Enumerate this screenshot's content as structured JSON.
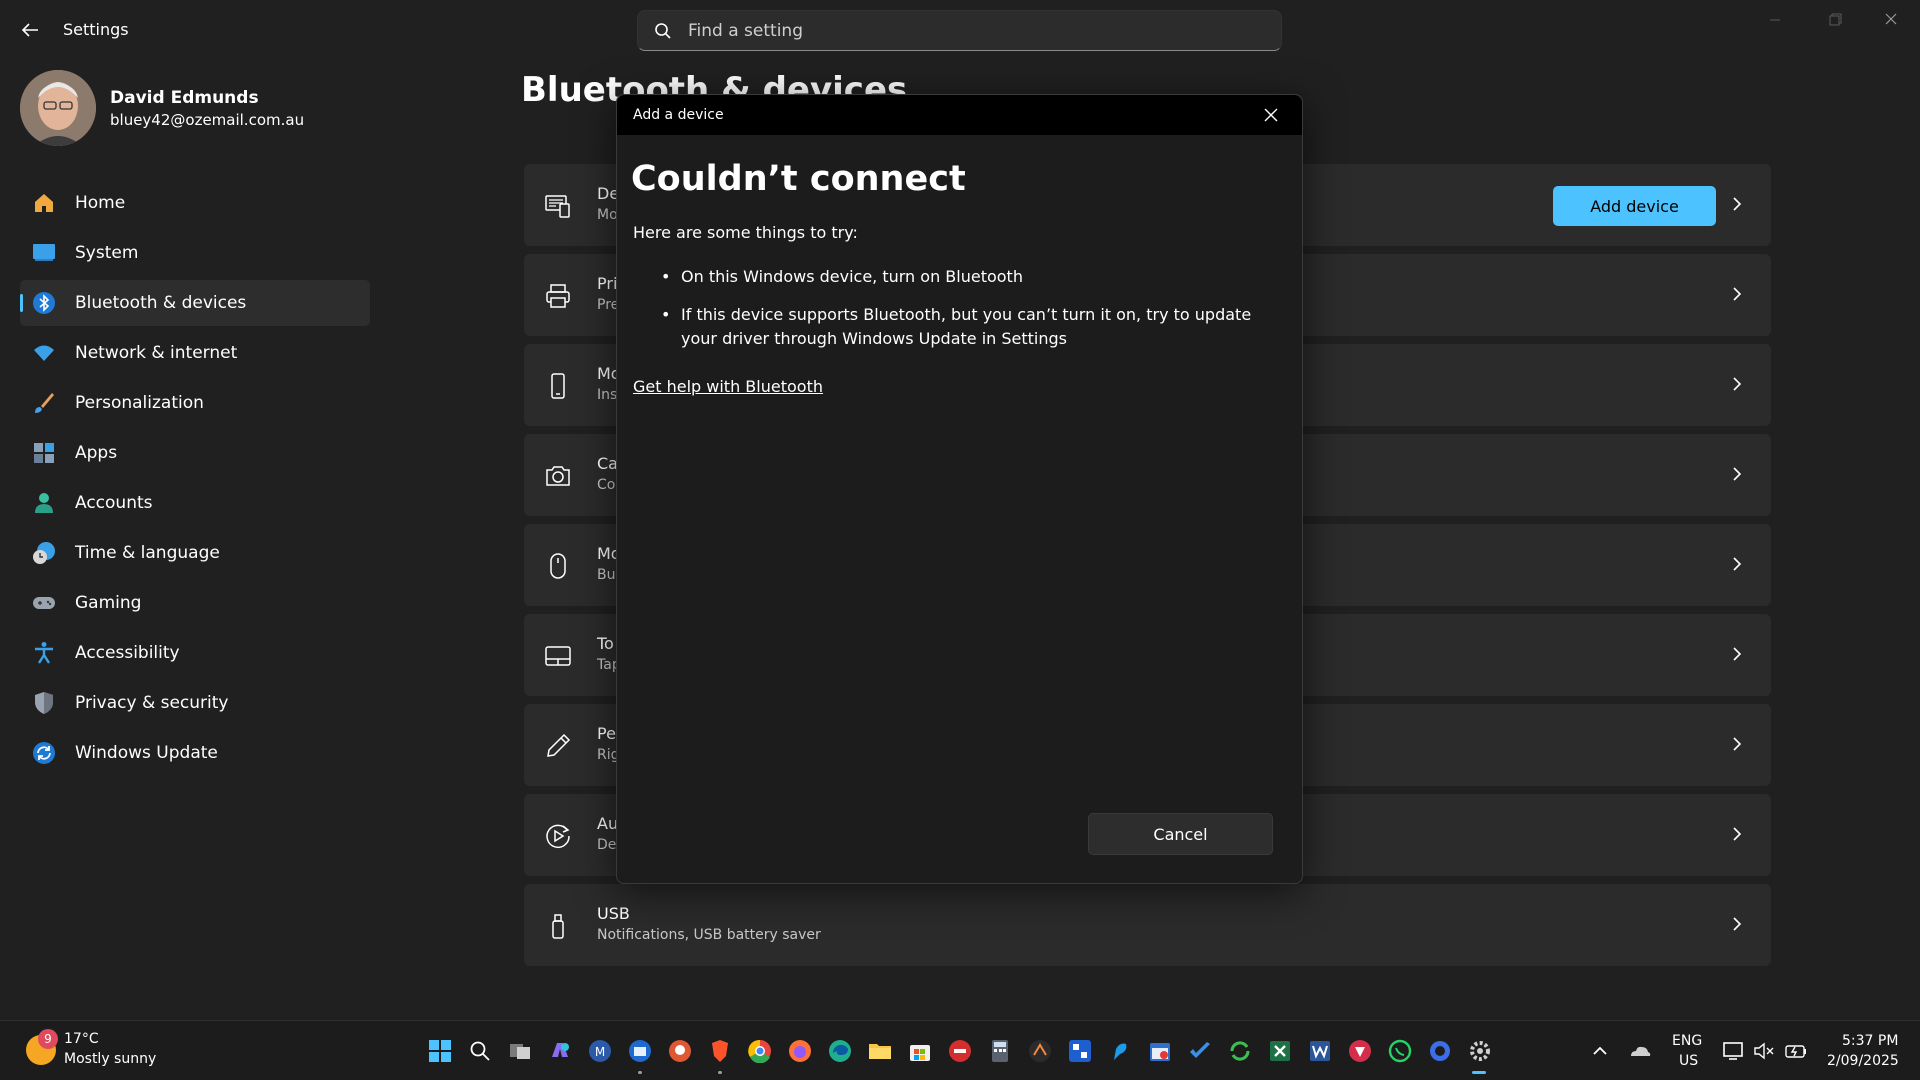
{
  "window": {
    "title": "Settings"
  },
  "search": {
    "placeholder": "Find a setting"
  },
  "profile": {
    "name": "David Edmunds",
    "email": "bluey42@ozemail.com.au"
  },
  "nav": {
    "items": [
      {
        "label": "Home",
        "icon": "home-icon"
      },
      {
        "label": "System",
        "icon": "system-icon"
      },
      {
        "label": "Bluetooth & devices",
        "icon": "bluetooth-icon",
        "selected": true
      },
      {
        "label": "Network & internet",
        "icon": "wifi-icon"
      },
      {
        "label": "Personalization",
        "icon": "brush-icon"
      },
      {
        "label": "Apps",
        "icon": "apps-icon"
      },
      {
        "label": "Accounts",
        "icon": "person-icon"
      },
      {
        "label": "Time & language",
        "icon": "clock-globe-icon"
      },
      {
        "label": "Gaming",
        "icon": "gamepad-icon"
      },
      {
        "label": "Accessibility",
        "icon": "accessibility-icon"
      },
      {
        "label": "Privacy & security",
        "icon": "shield-icon"
      },
      {
        "label": "Windows Update",
        "icon": "update-icon"
      }
    ]
  },
  "main": {
    "title": "Bluetooth & devices",
    "cards": [
      {
        "title": "De",
        "sub": "Mo",
        "icon": "devices-icon",
        "button": "Add device"
      },
      {
        "title": "Pri",
        "sub": "Pre",
        "icon": "printer-icon"
      },
      {
        "title": "Mo",
        "sub": "Ins",
        "icon": "phone-icon"
      },
      {
        "title": "Ca",
        "sub": "Co",
        "icon": "camera-icon"
      },
      {
        "title": "Mo",
        "sub": "Bu",
        "icon": "mouse-icon"
      },
      {
        "title": "To",
        "sub": "Tap",
        "icon": "touchpad-icon"
      },
      {
        "title": "Pe",
        "sub": "Rig",
        "icon": "pen-icon"
      },
      {
        "title": "Au",
        "sub": "De",
        "icon": "autoplay-icon"
      },
      {
        "title": "USB",
        "sub": "Notifications, USB battery saver",
        "icon": "usb-icon"
      }
    ]
  },
  "dialog": {
    "window_title": "Add a device",
    "heading": "Couldn’t connect",
    "intro": "Here are some things to try:",
    "tips": [
      "On this Windows device, turn on Bluetooth",
      "If this device supports Bluetooth, but you can’t turn it on, try to update your driver through Windows Update in Settings"
    ],
    "help_link": "Get help with Bluetooth",
    "cancel_label": "Cancel"
  },
  "taskbar": {
    "weather": {
      "badge": "9",
      "temp": "17°C",
      "condition": "Mostly sunny"
    },
    "tray": {
      "lang1": "ENG",
      "lang2": "US",
      "time": "5:37 PM",
      "date": "2/09/2025"
    }
  },
  "colors": {
    "accent": "#4cc2ff",
    "background": "#202020",
    "card": "#2b2b2b"
  }
}
